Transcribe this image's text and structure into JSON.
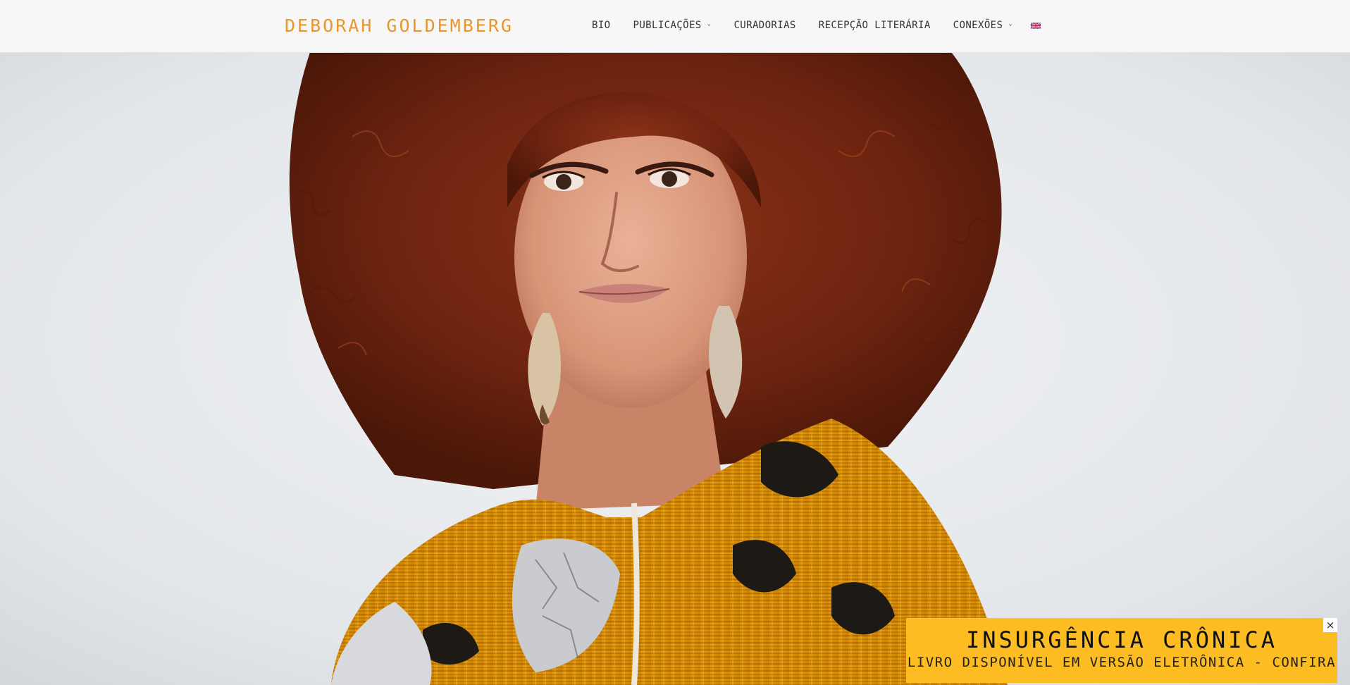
{
  "site": {
    "logo": "DEBORAH GOLDEMBERG",
    "accent_color": "#e8962c"
  },
  "nav": {
    "items": [
      {
        "label": "BIO",
        "has_dropdown": false
      },
      {
        "label": "PUBLICAÇÕES",
        "has_dropdown": true
      },
      {
        "label": "CURADORIAS",
        "has_dropdown": false
      },
      {
        "label": "RECEPÇÃO LITERÁRIA",
        "has_dropdown": false
      },
      {
        "label": "CONEXÕES",
        "has_dropdown": true
      }
    ],
    "language_flag": "uk-flag-icon"
  },
  "hero": {
    "image": "portrait-photo"
  },
  "promo": {
    "title": "INSURGÊNCIA CRÔNICA",
    "subtitle": "LIVRO DISPONÍVEL EM VERSÃO ELETRÔNICA - CONFIRA",
    "close_symbol": "×",
    "background_color": "#fcbc22"
  }
}
